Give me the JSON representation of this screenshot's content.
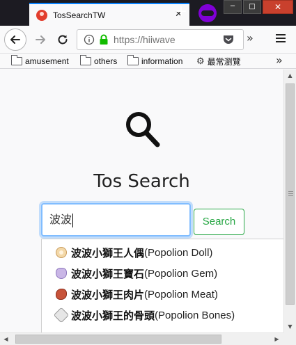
{
  "browser": {
    "tab": {
      "title": "TosSearchTW",
      "close_glyph": "✕"
    },
    "new_tab_glyph": "+",
    "window_controls": [
      "─",
      "□",
      "✕"
    ],
    "url": "https://hiiwave",
    "overflow_glyph": "»"
  },
  "bookmarks": {
    "items": [
      "amusement",
      "others",
      "information"
    ],
    "most_visited": "最常瀏覽",
    "more_glyph": "»"
  },
  "page": {
    "title": "Tos Search",
    "search": {
      "value": "波波",
      "button_label": "Search"
    },
    "suggestions": [
      {
        "name_zh": "波波小獅王人偶",
        "name_en": "(Popolion Doll)",
        "icon": "popolion-doll-icon"
      },
      {
        "name_zh": "波波小獅王寶石",
        "name_en": "(Popolion Gem)",
        "icon": "popolion-gem-icon"
      },
      {
        "name_zh": "波波小獅王肉片",
        "name_en": "(Popolion Meat)",
        "icon": "popolion-meat-icon"
      },
      {
        "name_zh": "波波小獅王的骨頭",
        "name_en": "(Popolion Bones)",
        "icon": "popolion-bones-icon"
      }
    ]
  },
  "colors": {
    "tab_accent": "#0a84ff",
    "search_button": "#28a745",
    "input_focus": "#80bdff",
    "private_browsing": "#8000d7"
  }
}
